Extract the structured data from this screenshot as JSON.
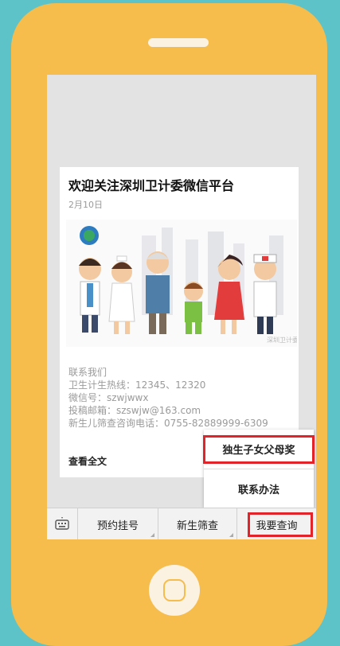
{
  "article": {
    "title": "欢迎关注深圳卫计委微信平台",
    "date": "2月10日",
    "contact_lines": [
      "联系我们",
      "卫生计生热线：12345、12320",
      "微信号：szwjwwx",
      "投稿邮箱：szswjw@163.com",
      "新生儿筛查咨询电话：0755-82889999-6309"
    ],
    "read_more": "查看全文",
    "watermark": "深圳卫计委"
  },
  "popup_menu": {
    "items": [
      "独生子女父母奖",
      "联系办法"
    ]
  },
  "menu_bar": {
    "keyboard_icon": "keyboard-icon",
    "buttons": [
      "预约挂号",
      "新生筛查",
      "我要查询"
    ]
  },
  "colors": {
    "background": "#5ec3c9",
    "phone_body": "#f6bc4c",
    "highlight": "#e2242a"
  }
}
